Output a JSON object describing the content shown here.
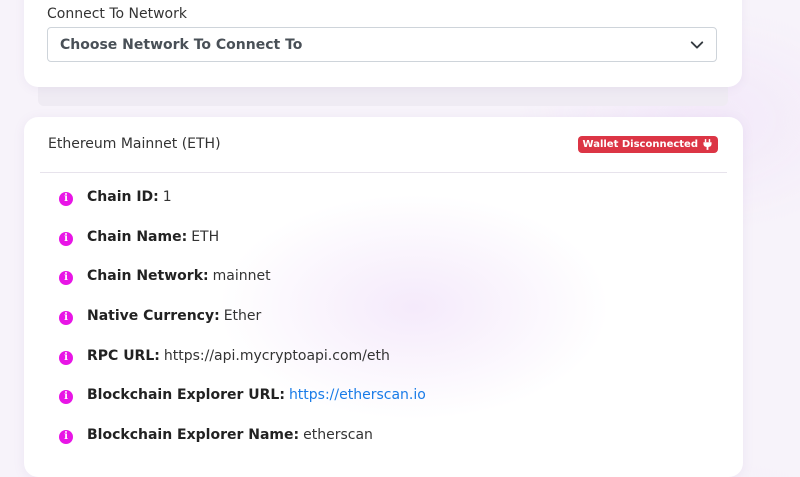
{
  "network_selector": {
    "label": "Connect To Network",
    "selected_value": "Choose Network To Connect To"
  },
  "network_card": {
    "title": "Ethereum Mainnet (ETH)",
    "status_badge": "Wallet Disconnected",
    "status_color": "#dc3545",
    "icon_color": "#e815e6",
    "link_color": "#1a7ce8",
    "details": [
      {
        "key": "Chain ID:",
        "value": "1"
      },
      {
        "key": "Chain Name:",
        "value": "ETH"
      },
      {
        "key": "Chain Network:",
        "value": "mainnet"
      },
      {
        "key": "Native Currency:",
        "value": "Ether"
      },
      {
        "key": "RPC URL:",
        "value": "https://api.mycryptoapi.com/eth"
      },
      {
        "key": "Blockchain Explorer URL:",
        "value": "https://etherscan.io"
      },
      {
        "key": "Blockchain Explorer Name:",
        "value": "etherscan"
      }
    ]
  }
}
